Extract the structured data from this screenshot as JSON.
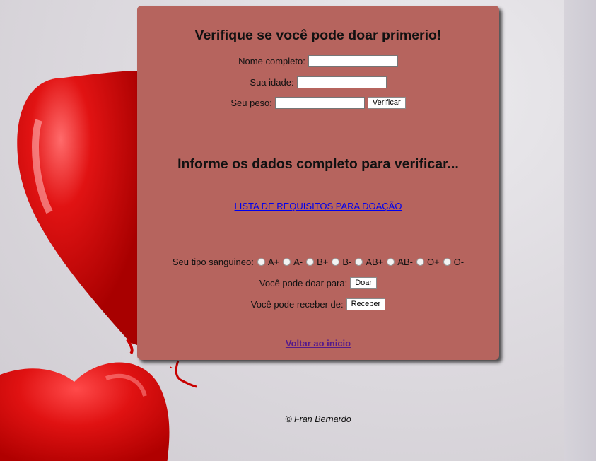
{
  "form": {
    "title": "Verifique se você pode doar primerio!",
    "name_label": "Nome completo:",
    "name_value": "",
    "age_label": "Sua idade:",
    "age_value": "",
    "weight_label": "Seu peso:",
    "weight_value": "",
    "verify_button": "Verificar"
  },
  "result": {
    "message": "Informe os dados completo para verificar..."
  },
  "requirements_link": "LISTA DE REQUISITOS PARA DOAÇÃO",
  "blood": {
    "label": "Seu tipo sanguineo:",
    "types": [
      "A+",
      "A-",
      "B+",
      "B-",
      "AB+",
      "AB-",
      "O+",
      "O-"
    ],
    "donate_label": "Você pode doar para:",
    "donate_button": "Doar",
    "receive_label": "Você pode receber de:",
    "receive_button": "Receber"
  },
  "back_link": "Voltar ao inicio",
  "footer": "© Fran Bernardo",
  "colors": {
    "card": "#b6645e",
    "link": "#0000ee",
    "visited_link": "#551a8b",
    "balloon": "#e01212"
  }
}
